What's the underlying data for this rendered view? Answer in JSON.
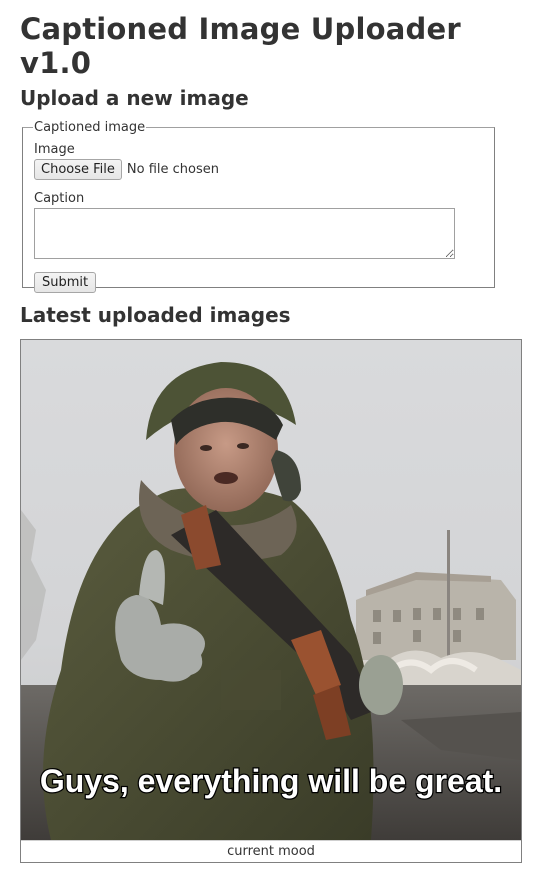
{
  "header": {
    "title": "Captioned Image Uploader v1.0",
    "upload_heading": "Upload a new image"
  },
  "form": {
    "legend": "Captioned image",
    "image_label": "Image",
    "choose_file_label": "Choose File",
    "file_status": "No file chosen",
    "caption_label": "Caption",
    "caption_value": "",
    "submit_label": "Submit"
  },
  "latest": {
    "heading": "Latest uploaded images",
    "items": [
      {
        "image_text": "Guys, everything will be great.",
        "caption": "current mood"
      }
    ]
  }
}
